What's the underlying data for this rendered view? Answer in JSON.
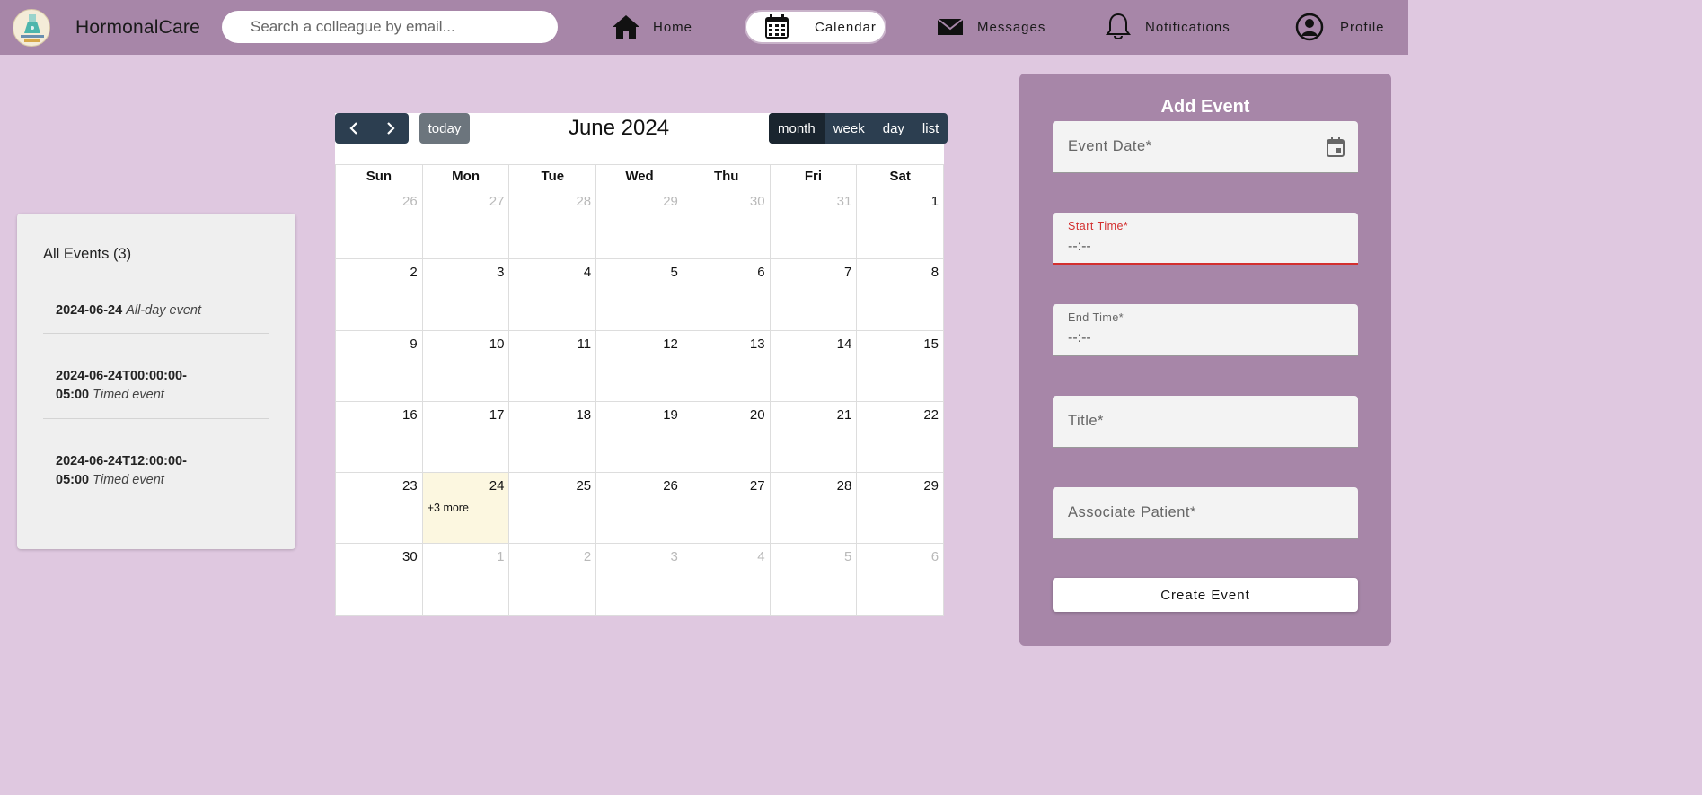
{
  "header": {
    "brand": "HormonalCare",
    "logo_text": "HORMONAL Care",
    "search_placeholder": "Search a colleague by email...",
    "nav": [
      {
        "label": "Home",
        "icon": "home-icon"
      },
      {
        "label": "Calendar",
        "icon": "calendar-icon",
        "active": true
      },
      {
        "label": "Messages",
        "icon": "envelope-icon"
      },
      {
        "label": "Notifications",
        "icon": "bell-icon"
      },
      {
        "label": "Profile",
        "icon": "user-circle-icon"
      }
    ]
  },
  "events": {
    "title": "All Events (3)",
    "items": [
      {
        "date": "2024-06-24",
        "name": "All-day event"
      },
      {
        "date": "2024-06-24T00:00:00-05:00",
        "name": "Timed event"
      },
      {
        "date": "2024-06-24T12:00:00-05:00",
        "name": "Timed event"
      }
    ]
  },
  "calendar": {
    "title": "June 2024",
    "today_label": "today",
    "views": [
      "month",
      "week",
      "day",
      "list"
    ],
    "active_view": "month",
    "weekdays": [
      "Sun",
      "Mon",
      "Tue",
      "Wed",
      "Thu",
      "Fri",
      "Sat"
    ],
    "weeks": [
      [
        {
          "d": "26",
          "o": true
        },
        {
          "d": "27",
          "o": true
        },
        {
          "d": "28",
          "o": true
        },
        {
          "d": "29",
          "o": true
        },
        {
          "d": "30",
          "o": true
        },
        {
          "d": "31",
          "o": true
        },
        {
          "d": "1"
        }
      ],
      [
        {
          "d": "2"
        },
        {
          "d": "3"
        },
        {
          "d": "4"
        },
        {
          "d": "5"
        },
        {
          "d": "6"
        },
        {
          "d": "7"
        },
        {
          "d": "8"
        }
      ],
      [
        {
          "d": "9"
        },
        {
          "d": "10"
        },
        {
          "d": "11"
        },
        {
          "d": "12"
        },
        {
          "d": "13"
        },
        {
          "d": "14"
        },
        {
          "d": "15"
        }
      ],
      [
        {
          "d": "16"
        },
        {
          "d": "17"
        },
        {
          "d": "18"
        },
        {
          "d": "19"
        },
        {
          "d": "20"
        },
        {
          "d": "21"
        },
        {
          "d": "22"
        }
      ],
      [
        {
          "d": "23"
        },
        {
          "d": "24",
          "today": true,
          "more": "+3 more"
        },
        {
          "d": "25"
        },
        {
          "d": "26"
        },
        {
          "d": "27"
        },
        {
          "d": "28"
        },
        {
          "d": "29"
        }
      ],
      [
        {
          "d": "30"
        },
        {
          "d": "1",
          "o": true
        },
        {
          "d": "2",
          "o": true
        },
        {
          "d": "3",
          "o": true
        },
        {
          "d": "4",
          "o": true
        },
        {
          "d": "5",
          "o": true
        },
        {
          "d": "6",
          "o": true
        }
      ]
    ]
  },
  "form": {
    "title": "Add Event",
    "event_date_label": "Event Date*",
    "start_time_label": "Start Time*",
    "start_time_value": "--:--",
    "end_time_label": "End Time*",
    "end_time_value": "--:--",
    "title_label": "Title*",
    "patient_label": "Associate Patient*",
    "submit_label": "Create Event"
  },
  "colors": {
    "header_bg": "#a786a8",
    "page_bg": "#dfc8e0",
    "toolbar_dark": "#2c3e50",
    "today_bg": "#fcf7e0",
    "error": "#d32f2f"
  }
}
